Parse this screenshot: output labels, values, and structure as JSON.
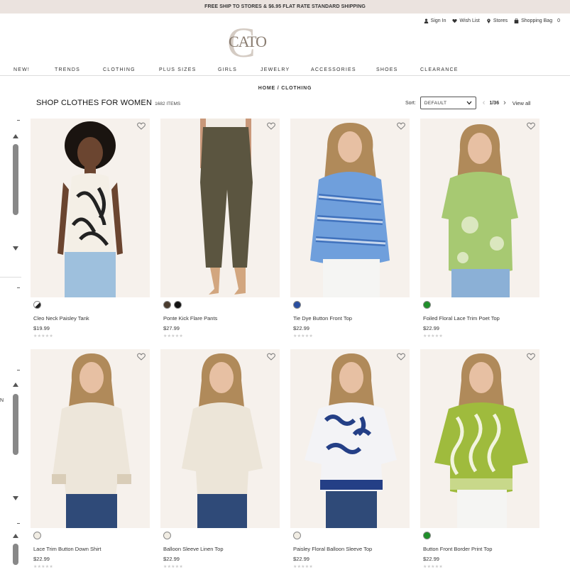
{
  "promo": "FREE SHIP TO STORES & $6.95 FLAT RATE STANDARD SHIPPING",
  "util": {
    "sign_in": "Sign In",
    "wish_list": "Wish List",
    "stores": "Stores",
    "bag": "Shopping Bag",
    "bag_count": "0"
  },
  "logo": {
    "text": "CATO",
    "letter": "C"
  },
  "nav": [
    "NEW!",
    "TRENDS",
    "CLOTHING",
    "PLUS SIZES",
    "GIRLS",
    "JEWELRY",
    "ACCESSORIES",
    "SHOES",
    "CLEARANCE"
  ],
  "breadcrumb": {
    "home": "HOME",
    "sep": "/",
    "current": "CLOTHING"
  },
  "heading": {
    "title": "SHOP CLOTHES FOR WOMEN",
    "count": "1682 ITEMS"
  },
  "sort": {
    "label": "Sort:",
    "value": "DEFAULT"
  },
  "pager": {
    "current": "1/36",
    "view_all": "View all"
  },
  "side_letter": "N",
  "colors": {
    "promo_bg": "#ebe3df",
    "image_bg": "#f6f1ec",
    "logo": "#a89b8f"
  },
  "products": [
    {
      "name": "Cleo Neck Paisley Tank",
      "price": "$19.99",
      "swatches": [
        "paisley-bw"
      ]
    },
    {
      "name": "Ponte Kick Flare Pants",
      "price": "$27.99",
      "swatches": [
        "#4a3b2e",
        "#111111"
      ]
    },
    {
      "name": "Tie Dye Button Front Top",
      "price": "$22.99",
      "swatches": [
        "#2a4fa0"
      ]
    },
    {
      "name": "Foiled Floral Lace Trim Poet Top",
      "price": "$22.99",
      "swatches": [
        "#1f8f2a"
      ]
    },
    {
      "name": "Lace Trim Button Down Shirt",
      "price": "$22.99",
      "swatches": [
        "#f1ede4"
      ]
    },
    {
      "name": "Balloon Sleeve Linen Top",
      "price": "$22.99",
      "swatches": [
        "#f1ede4"
      ]
    },
    {
      "name": "Paisley Floral Balloon Sleeve Top",
      "price": "$22.99",
      "swatches": [
        "#f1ede4"
      ]
    },
    {
      "name": "Button Front Border Print Top",
      "price": "$22.99",
      "swatches": [
        "#1f8f2a"
      ]
    }
  ],
  "stars": "★★★★★"
}
